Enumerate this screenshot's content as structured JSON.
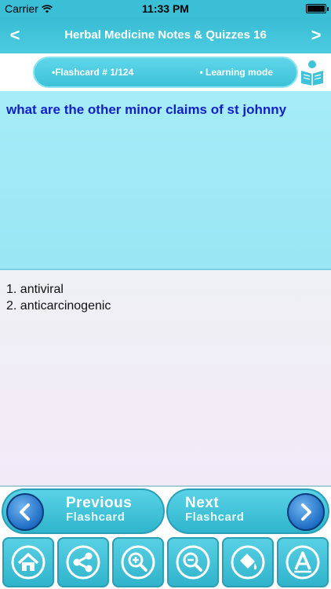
{
  "status_bar": {
    "carrier": "Carrier",
    "time": "11:33 PM"
  },
  "nav_bar": {
    "title": "Herbal Medicine Notes & Quizzes 16",
    "back_icon": "chevron-left-icon",
    "forward_icon": "chevron-right-icon"
  },
  "info": {
    "flashcard_label": "•Flashcard #  1/124",
    "mode_label": "• Learning mode",
    "mode_icon": "reader-icon"
  },
  "question": {
    "text": "what are the other minor claims of st johnny"
  },
  "answer": {
    "lines": [
      "1. antiviral",
      "2. anticarcinogenic"
    ]
  },
  "card_nav": {
    "previous": {
      "line1": "Previous",
      "line2": "Flashcard"
    },
    "next": {
      "line1": "Next",
      "line2": "Flashcard"
    }
  },
  "toolbar": {
    "items": [
      {
        "icon": "home-icon"
      },
      {
        "icon": "share-icon"
      },
      {
        "icon": "zoom-in-icon"
      },
      {
        "icon": "zoom-out-icon"
      },
      {
        "icon": "paint-bucket-icon"
      },
      {
        "icon": "font-icon"
      }
    ]
  },
  "colors": {
    "accent": "#3bbfd6",
    "question_bg": "#a6ecf8",
    "question_text": "#1320c8",
    "answer_bg": "#eef0f4",
    "arrow_blue": "#1f6dc5"
  }
}
